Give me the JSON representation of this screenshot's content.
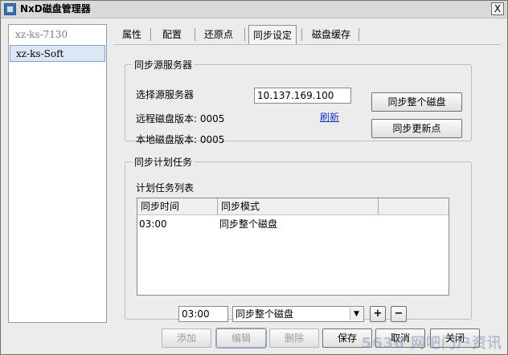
{
  "window": {
    "title": "NxD磁盘管理器",
    "close_label": "X"
  },
  "servers": [
    "xz-ks-7130",
    "xz-ks-Soft"
  ],
  "tabs": [
    "属性",
    "配置",
    "还原点",
    "同步设定",
    "磁盘缓存"
  ],
  "active_tab": "同步设定",
  "source_group": {
    "legend": "同步源服务器",
    "select_label": "选择源服务器",
    "server_ip": "10.137.169.100",
    "remote_version": "远程磁盘版本: 0005",
    "local_version": "本地磁盘版本: 0005",
    "refresh_label": "刷新",
    "sync_disk_button": "同步整个磁盘",
    "sync_update_button": "同步更新点"
  },
  "schedule_group": {
    "legend": "同步计划任务",
    "list_label": "计划任务列表",
    "columns": [
      "同步时间",
      "同步模式"
    ],
    "rows": [
      {
        "time": "03:00",
        "mode": "同步整个磁盘"
      }
    ],
    "time_input": "03:00",
    "mode_select": "同步整个磁盘",
    "add_label": "+",
    "remove_label": "−"
  },
  "bottom_buttons": {
    "add": "添加",
    "edit": "编辑",
    "delete": "删除",
    "save": "保存",
    "cancel": "取消",
    "close": "关闭"
  },
  "watermark": "5636 网吧门户资讯"
}
